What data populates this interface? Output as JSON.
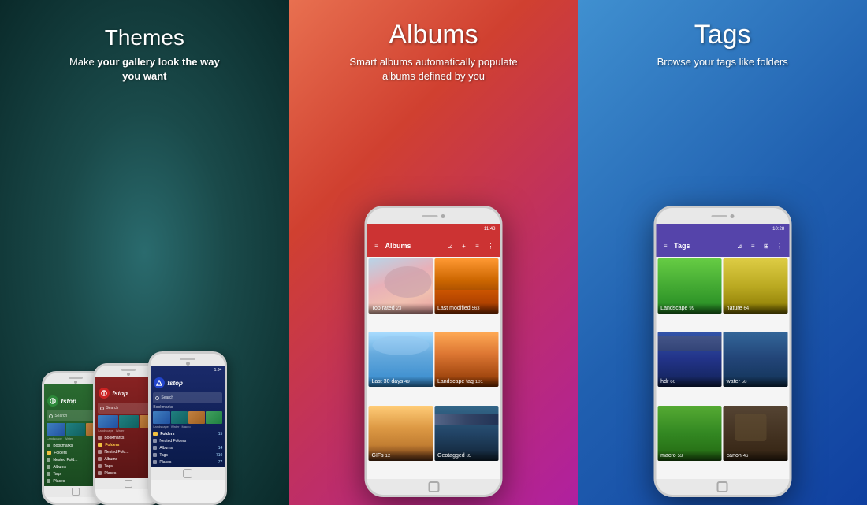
{
  "panels": [
    {
      "id": "themes",
      "title": "Themes",
      "subtitle_html": "Make <strong>your gallery look the way</strong><br><strong>you want</strong>",
      "subtitle": "Make your gallery look the way you want",
      "bg": "panel-1"
    },
    {
      "id": "albums",
      "title": "Albums",
      "subtitle": "Smart albums automatically populate albums defined by you",
      "bg": "panel-2"
    },
    {
      "id": "tags",
      "title": "Tags",
      "subtitle": "Browse your tags like folders",
      "bg": "panel-3"
    }
  ],
  "albums_screen": {
    "status_time": "11:43",
    "bar_title": "Albums",
    "items": [
      {
        "label": "Top rated",
        "count": "23",
        "bg": "bg-toprated"
      },
      {
        "label": "Last modified",
        "count": "563",
        "bg": "bg-lastmodified"
      },
      {
        "label": "Last 30 days",
        "count": "49",
        "bg": "bg-last30"
      },
      {
        "label": "Landscape tag",
        "count": "101",
        "bg": "bg-landscape"
      },
      {
        "label": "GIFs",
        "count": "12",
        "bg": "bg-gifs"
      },
      {
        "label": "Geotagged",
        "count": "85",
        "bg": "bg-geotagged"
      }
    ]
  },
  "tags_screen": {
    "status_time": "10:28",
    "bar_title": "Tags",
    "items": [
      {
        "label": "Landscape",
        "count": "99",
        "bg": "bg-landscape-tag"
      },
      {
        "label": "nature",
        "count": "64",
        "bg": "bg-nature-tag"
      },
      {
        "label": "hdr",
        "count": "60",
        "bg": "bg-hdr-tag"
      },
      {
        "label": "water",
        "count": "58",
        "bg": "bg-water-tag"
      },
      {
        "label": "macro",
        "count": "53",
        "bg": "bg-macro-tag"
      },
      {
        "label": "canon",
        "count": "46",
        "bg": "bg-canon-tag"
      }
    ]
  },
  "left_phones": {
    "screens": [
      {
        "theme": "screen-g",
        "logo_bg": "#2d8a3a",
        "accent": "#2d8a3a"
      },
      {
        "theme": "screen-r",
        "logo_bg": "#cc2222",
        "accent": "#cc2222"
      },
      {
        "theme": "screen-b",
        "logo_bg": "#2244cc",
        "accent": "#2244cc"
      }
    ],
    "menu_items": [
      "Search",
      "Bookmarks",
      "Folders",
      "Nested Folders",
      "Albums",
      "Tags",
      "Places"
    ],
    "folder_label": "Folders"
  }
}
